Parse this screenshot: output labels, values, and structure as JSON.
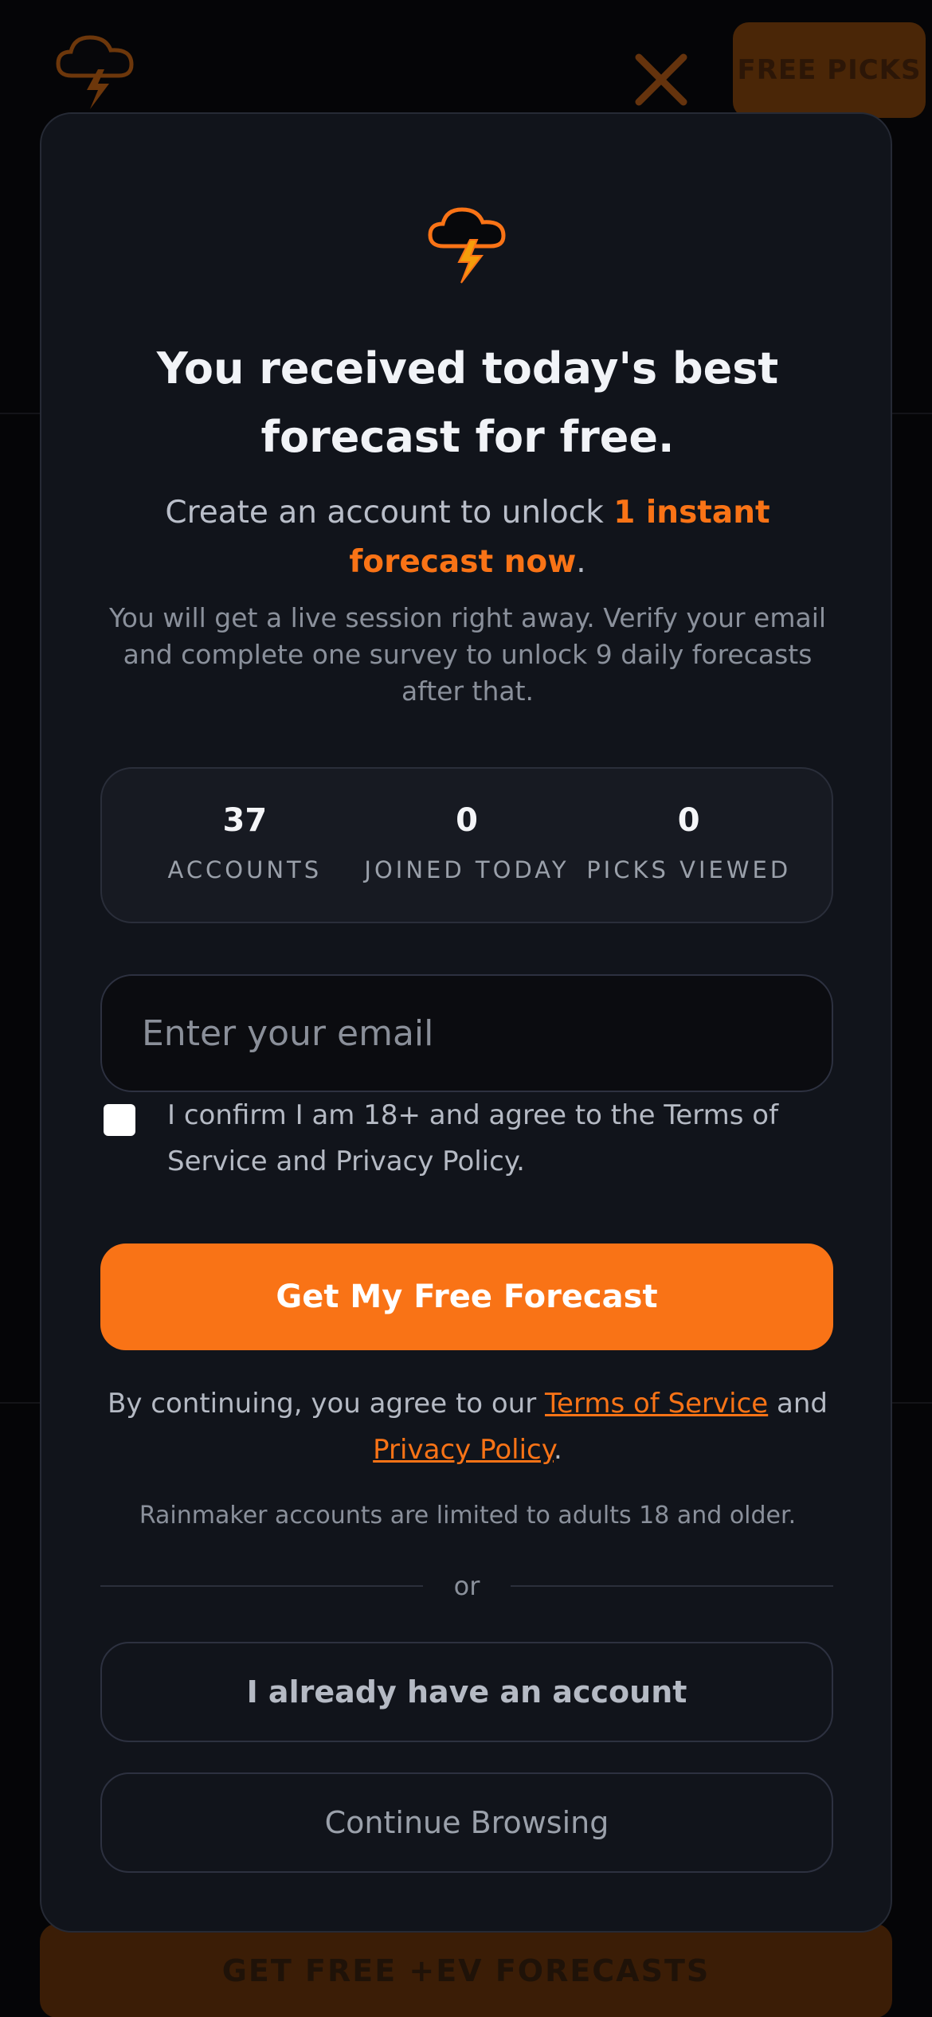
{
  "background": {
    "free_picks_label": "FREE PICKS",
    "cta_label": "GET FREE +EV FORECASTS",
    "logo_icon": "storm-cloud-icon",
    "close_icon": "close-icon"
  },
  "modal": {
    "logo_icon": "storm-cloud-lightning-icon",
    "title": "You received today's best forecast for free.",
    "subtitle_prefix": "Create an account to unlock ",
    "subtitle_highlight": "1 instant forecast now",
    "subtitle_suffix": ".",
    "description": "You will get a live session right away. Verify your email and complete one survey to unlock 9 daily forecasts after that.",
    "stats": [
      {
        "value": "37",
        "label": "ACCOUNTS"
      },
      {
        "value": "0",
        "label": "JOINED TODAY"
      },
      {
        "value": "0",
        "label": "PICKS VIEWED"
      }
    ],
    "email_placeholder": "Enter your email",
    "email_value": "",
    "consent_checked": false,
    "consent_text": "I confirm I am 18+ and agree to the Terms of Service and Privacy Policy.",
    "submit_label": "Get My Free Forecast",
    "legal_prefix": "By continuing, you agree to our ",
    "terms_link": "Terms of Service",
    "legal_and": " and ",
    "privacy_link": "Privacy Policy",
    "legal_suffix": ".",
    "age_note": "Rainmaker accounts are limited to adults 18 and older.",
    "divider_text": "or",
    "login_label": "I already have an account",
    "browse_label": "Continue Browsing"
  },
  "colors": {
    "accent": "#f97316",
    "modal_bg": "#11141b",
    "page_bg": "#050507"
  }
}
